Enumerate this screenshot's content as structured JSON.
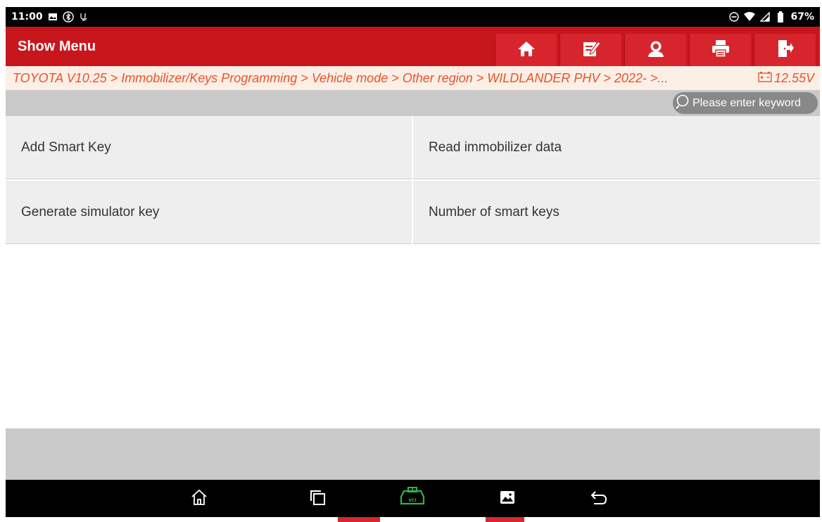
{
  "status_bar": {
    "time": "11:00",
    "battery": "67%",
    "left_icons": [
      "image-notification-icon",
      "bluetooth-icon",
      "diagnostic-icon"
    ],
    "right_icons": [
      "do-not-disturb-icon",
      "wifi-icon",
      "signal-icon",
      "battery-icon"
    ]
  },
  "header": {
    "title": "Show Menu",
    "toolbar": [
      "home-icon",
      "edit-report-icon",
      "remote-support-icon",
      "print-icon",
      "exit-icon"
    ]
  },
  "breadcrumb": {
    "path": "TOYOTA V10.25 > Immobilizer/Keys Programming > Vehicle mode > Other region > WILDLANDER PHV > 2022- >...",
    "voltage": "12.55V"
  },
  "search": {
    "placeholder": "Please enter keyword"
  },
  "menu": {
    "items": [
      {
        "label": "Add Smart Key"
      },
      {
        "label": "Read immobilizer data"
      },
      {
        "label": "Generate simulator key"
      },
      {
        "label": "Number of smart keys"
      }
    ]
  },
  "nav_bar": [
    "home-icon",
    "recents-icon",
    "vci-icon",
    "screenshot-icon",
    "back-icon"
  ],
  "colors": {
    "header_red": "#c8161d",
    "breadcrumb_text": "#e8532c",
    "vci_green": "#2db34a"
  }
}
